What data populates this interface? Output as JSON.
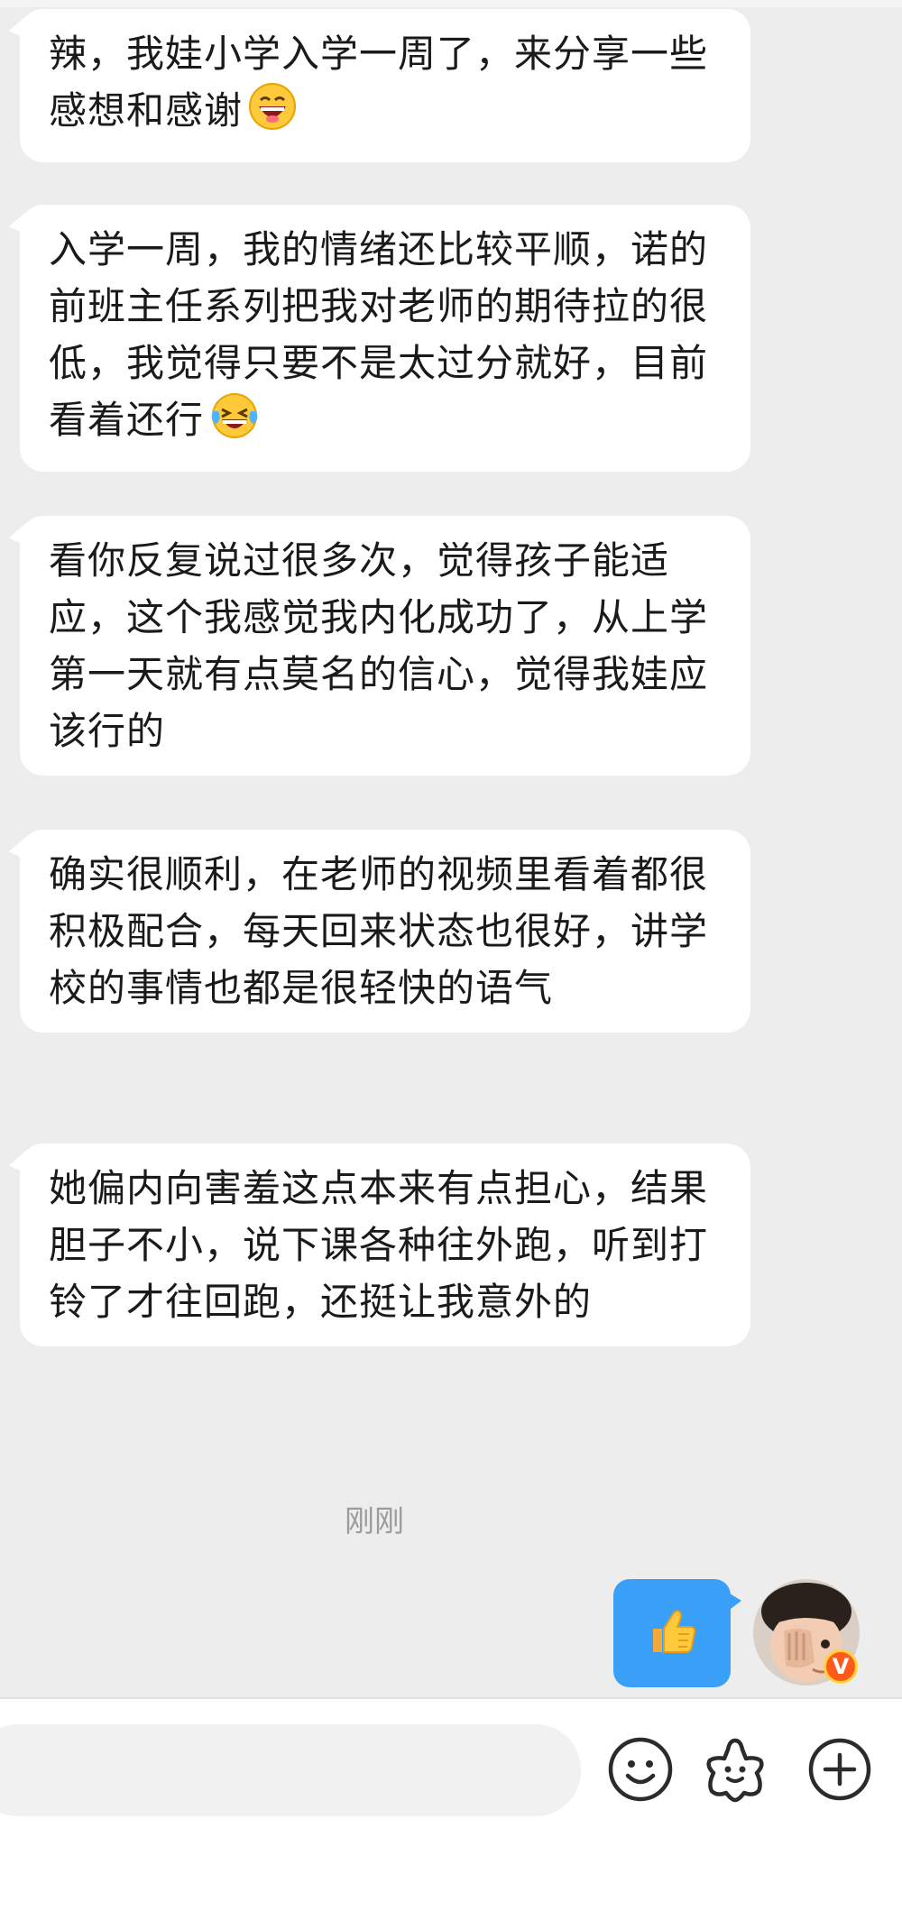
{
  "messages": [
    {
      "text": "辣，我娃小学入学一周了，来分享一些感想和感谢",
      "emoji": "grin-face"
    },
    {
      "text": "入学一周，我的情绪还比较平顺，诺的前班主任系列把我对老师的期待拉的很低，我觉得只要不是太过分就好，目前看着还行",
      "emoji": "laughing-tears-face"
    },
    {
      "text": "看你反复说过很多次，觉得孩子能适应，这个我感觉我内化成功了，从上学第一天就有点莫名的信心，觉得我娃应该行的"
    },
    {
      "text": "确实很顺利，在老师的视频里看着都很积极配合，每天回来状态也很好，讲学校的事情也都是很轻快的语气"
    },
    {
      "text": "她偏内向害羞这点本来有点担心，结果胆子不小，说下课各种往外跑，听到打铃了才往回跑，还挺让我意外的"
    }
  ],
  "timestamp": "刚刚",
  "my_message": {
    "emoji": "thumbs-up"
  },
  "avatar_badge": "V",
  "input": {
    "placeholder": ""
  },
  "icons": [
    "emoji-icon",
    "sticker-icon",
    "plus-icon"
  ],
  "colors": {
    "my_bubble": "#3aa0f7",
    "background": "#ededed",
    "badge": "#ff5a1a"
  }
}
